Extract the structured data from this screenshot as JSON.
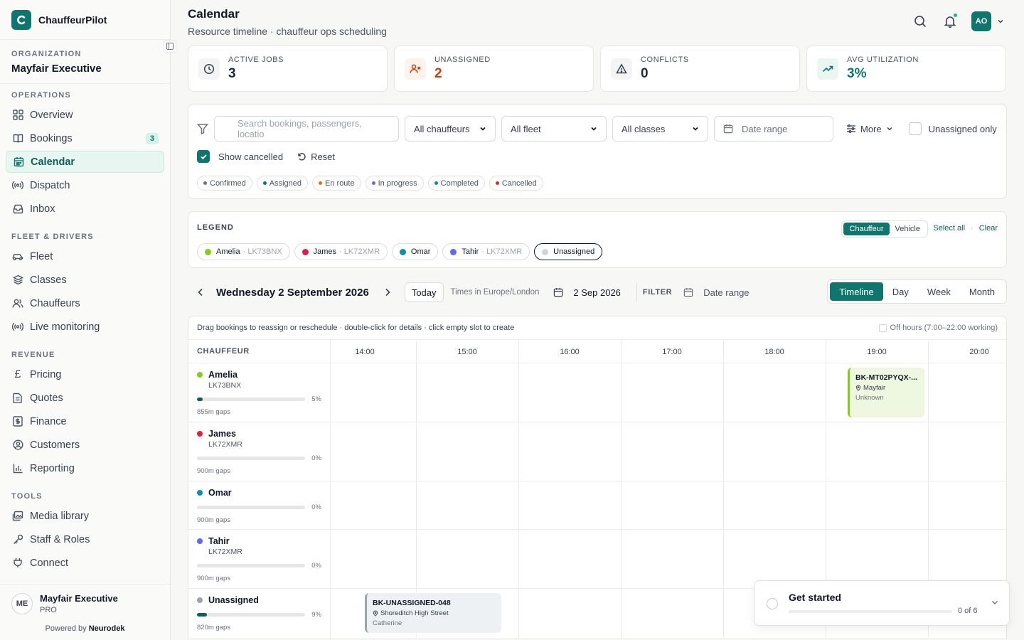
{
  "app": {
    "name": "ChauffeurPilot",
    "logo_letter": "C"
  },
  "organization": {
    "label": "ORGANIZATION",
    "name": "Mayfair Executive"
  },
  "nav": {
    "operations": {
      "label": "OPERATIONS",
      "items": [
        {
          "label": "Overview",
          "icon": "grid-icon"
        },
        {
          "label": "Bookings",
          "icon": "book-icon",
          "badge": "3"
        },
        {
          "label": "Calendar",
          "icon": "calendar-icon",
          "active": true
        },
        {
          "label": "Dispatch",
          "icon": "radio-icon"
        },
        {
          "label": "Inbox",
          "icon": "inbox-icon"
        }
      ]
    },
    "fleet": {
      "label": "FLEET & DRIVERS",
      "items": [
        {
          "label": "Fleet",
          "icon": "car-icon"
        },
        {
          "label": "Classes",
          "icon": "layers-icon"
        },
        {
          "label": "Chauffeurs",
          "icon": "users-icon"
        },
        {
          "label": "Live monitoring",
          "icon": "radio-icon"
        }
      ]
    },
    "revenue": {
      "label": "REVENUE",
      "items": [
        {
          "label": "Pricing",
          "icon": "pound-icon"
        },
        {
          "label": "Quotes",
          "icon": "file-icon"
        },
        {
          "label": "Finance",
          "icon": "dollar-icon"
        },
        {
          "label": "Customers",
          "icon": "user-circle-icon"
        },
        {
          "label": "Reporting",
          "icon": "bar-chart-icon"
        }
      ]
    },
    "tools": {
      "label": "TOOLS",
      "items": [
        {
          "label": "Media library",
          "icon": "image-icon"
        },
        {
          "label": "Staff & Roles",
          "icon": "key-icon"
        },
        {
          "label": "Connect",
          "icon": "plug-icon"
        }
      ]
    }
  },
  "footer": {
    "avatar": "ME",
    "name": "Mayfair Executive",
    "plan": "PRO",
    "powered_prefix": "Powered by",
    "powered_brand": "Neurodek"
  },
  "header": {
    "title": "Calendar",
    "subtitle": "Resource timeline · chauffeur ops scheduling",
    "user_initials": "AO"
  },
  "stats": [
    {
      "label": "ACTIVE JOBS",
      "value": "3",
      "icon": "clock-icon"
    },
    {
      "label": "UNASSIGNED",
      "value": "2",
      "icon": "user-x-icon"
    },
    {
      "label": "CONFLICTS",
      "value": "0",
      "icon": "warning-icon"
    },
    {
      "label": "AVG UTILIZATION",
      "value": "3%",
      "icon": "trend-up-icon"
    }
  ],
  "filters": {
    "search_placeholder": "Search bookings, passengers, locatio",
    "chauffeurs": "All chauffeurs",
    "fleet": "All fleet",
    "classes": "All classes",
    "date_placeholder": "Date range",
    "more": "More",
    "unassigned_only": "Unassigned only",
    "show_cancelled": "Show cancelled",
    "reset": "Reset",
    "statuses": [
      {
        "label": "Confirmed",
        "color": "#6b7280"
      },
      {
        "label": "Assigned",
        "color": "#0f766e"
      },
      {
        "label": "En route",
        "color": "#d97706"
      },
      {
        "label": "In progress",
        "color": "#6366f1"
      },
      {
        "label": "Completed",
        "color": "#059669"
      },
      {
        "label": "Cancelled",
        "color": "#dc2626"
      }
    ]
  },
  "legend": {
    "title": "LEGEND",
    "toggle": [
      "Chauffeur",
      "Vehicle"
    ],
    "select_all": "Select all",
    "clear": "Clear",
    "items": [
      {
        "name": "Amelia",
        "plate": "· LK73BNX",
        "color": "#84cc16"
      },
      {
        "name": "James",
        "plate": "· LK72XMR",
        "color": "#e11d48"
      },
      {
        "name": "Omar",
        "plate": "",
        "color": "#0891b2"
      },
      {
        "name": "Tahir",
        "plate": "· LK72XMR",
        "color": "#6366f1"
      },
      {
        "name": "Unassigned",
        "plate": "",
        "color": "#d1d5db"
      }
    ]
  },
  "toolbar": {
    "date": "Wednesday 2 September 2026",
    "today": "Today",
    "timezone": "Times in Europe/London",
    "selected_date": "2 Sep 2026",
    "filter_label": "FILTER",
    "date_range": "Date range",
    "views": [
      "Timeline",
      "Day",
      "Week",
      "Month"
    ]
  },
  "timeline": {
    "hint": "Drag bookings to reassign or reschedule · double-click for details · click empty slot to create",
    "off_hours": "Off hours (7:00–22:00 working)",
    "column_label": "CHAUFFEUR",
    "hours": [
      "14:00",
      "15:00",
      "16:00",
      "17:00",
      "18:00",
      "19:00",
      "20:00"
    ],
    "rows": [
      {
        "name": "Amelia",
        "plate": "LK73BNX",
        "color": "#84cc16",
        "util": 5,
        "util_label": "5%",
        "gaps": "855m gaps"
      },
      {
        "name": "James",
        "plate": "LK72XMR",
        "color": "#e11d48",
        "util": 0,
        "util_label": "0%",
        "gaps": "900m gaps"
      },
      {
        "name": "Omar",
        "plate": "",
        "color": "#0891b2",
        "util": 0,
        "util_label": "0%",
        "gaps": "900m gaps"
      },
      {
        "name": "Tahir",
        "plate": "LK72XMR",
        "color": "#6366f1",
        "util": 0,
        "util_label": "0%",
        "gaps": "900m gaps"
      },
      {
        "name": "Unassigned",
        "plate": "",
        "color": "#9ca3af",
        "util": 9,
        "util_label": "9%",
        "gaps": "820m gaps"
      }
    ],
    "bookings": [
      {
        "id": "BK-MT02PYQX-...",
        "location": "Mayfair",
        "sub": "Unknown"
      },
      {
        "id": "BK-UNASSIGNED-048",
        "location": "Shoreditch High Street",
        "sub": "Catherine"
      }
    ]
  },
  "get_started": {
    "title": "Get started",
    "progress": "0 of 6"
  }
}
